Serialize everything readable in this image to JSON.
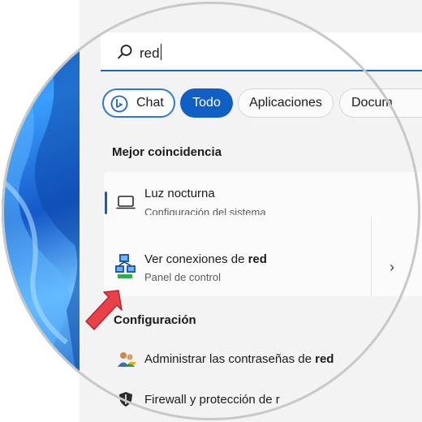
{
  "search": {
    "query": "red"
  },
  "filters": [
    {
      "label": "Chat"
    },
    {
      "label": "Todo"
    },
    {
      "label": "Aplicaciones"
    },
    {
      "label": "Docum"
    }
  ],
  "best_match": {
    "heading": "Mejor coincidencia",
    "items": [
      {
        "title": "Luz nocturna",
        "subtitle": "Configuración del sistema"
      },
      {
        "title_prefix": "Ver conexiones de ",
        "title_bold": "red",
        "subtitle": "Panel de control"
      }
    ]
  },
  "settings": {
    "heading": "Configuración",
    "items": [
      {
        "title_prefix": "Administrar las contraseñas de ",
        "title_bold": "red"
      },
      {
        "title_prefix": "Firewall y protección de r"
      }
    ]
  },
  "colors": {
    "accent": "#0f5fc4",
    "arrow": "#e8414a"
  }
}
